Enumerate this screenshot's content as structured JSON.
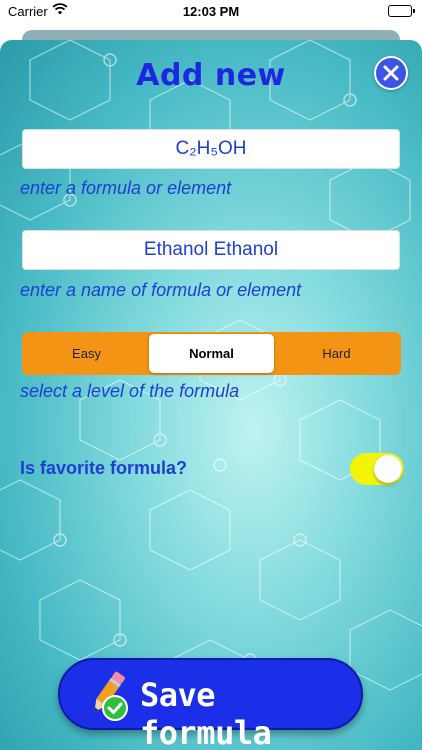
{
  "status_bar": {
    "carrier": "Carrier",
    "time": "12:03 PM",
    "icons": [
      "wifi-icon",
      "battery-icon"
    ]
  },
  "header": {
    "title": "Add new",
    "close_icon": "close-icon"
  },
  "formula_field": {
    "value": "C₂H₅OH",
    "hint": "enter a formula or element"
  },
  "name_field": {
    "value": "Ethanol Ethanol",
    "hint": "enter a name of formula or element"
  },
  "level": {
    "options": [
      "Easy",
      "Normal",
      "Hard"
    ],
    "selected": "Normal",
    "hint": "select a level of the formula"
  },
  "favorite": {
    "label": "Is favorite formula?",
    "on": true
  },
  "save_button": {
    "label": "Save formula",
    "icon": "pencil-check-icon"
  },
  "colors": {
    "accent_blue": "#1f26e0",
    "segment_orange": "#f39415",
    "toggle_yellow": "#f4f40a",
    "save_blue": "#1c2fe8"
  }
}
